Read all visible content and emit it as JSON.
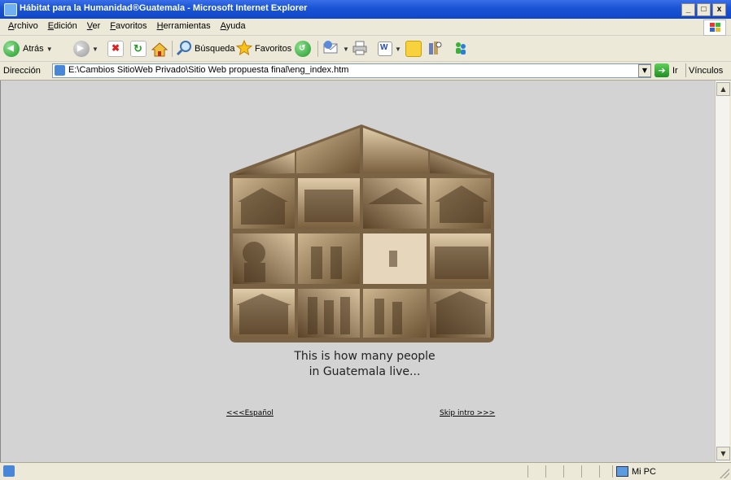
{
  "window": {
    "title": "Hábitat para la Humanidad®Guatemala - Microsoft Internet Explorer",
    "minimize": "_",
    "maximize": "□",
    "close": "x"
  },
  "menu": [
    "Archivo",
    "Edición",
    "Ver",
    "Favoritos",
    "Herramientas",
    "Ayuda"
  ],
  "toolbar": {
    "back_label": "Atrás",
    "search_label": "Búsqueda",
    "favorites_label": "Favoritos"
  },
  "address": {
    "label": "Dirección",
    "url": "E:\\Cambios SitioWeb Privado\\Sitio Web propuesta final\\eng_index.htm",
    "go_label": "Ir",
    "links_label": "Vínculos"
  },
  "page": {
    "caption_line1": "This is how many people",
    "caption_line2": "in Guatemala live...",
    "spanish_link": "<<<Español",
    "skip_link": "Skip intro >>>"
  },
  "status": {
    "zone": "Mi PC"
  },
  "colors": {
    "titlebar": "#1b55d6",
    "content_bg": "#d3d3d3",
    "house_frame": "#7a6344",
    "sepia": "#a78862"
  }
}
